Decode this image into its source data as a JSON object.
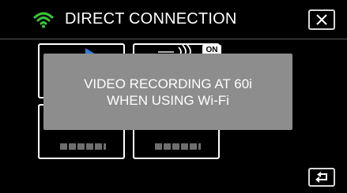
{
  "header": {
    "title": "DIRECT CONNECTION",
    "wifi_icon": "wifi-icon",
    "close_icon": "close-icon"
  },
  "tiles": [
    {
      "icon": "play-icon"
    },
    {
      "icon": "wifi-signal-icon",
      "badge": "ON"
    },
    {
      "icon": "none"
    },
    {
      "icon": "none"
    }
  ],
  "message": {
    "line1": "VIDEO RECORDING AT 60i",
    "line2": "WHEN USING Wi-Fi"
  },
  "footer": {
    "back_icon": "return-icon"
  },
  "colors": {
    "background": "#000000",
    "message_box": "#8d8d8d",
    "wifi_green": "#3cc43c",
    "play_blue": "#2a7fd6",
    "text": "#ffffff"
  }
}
